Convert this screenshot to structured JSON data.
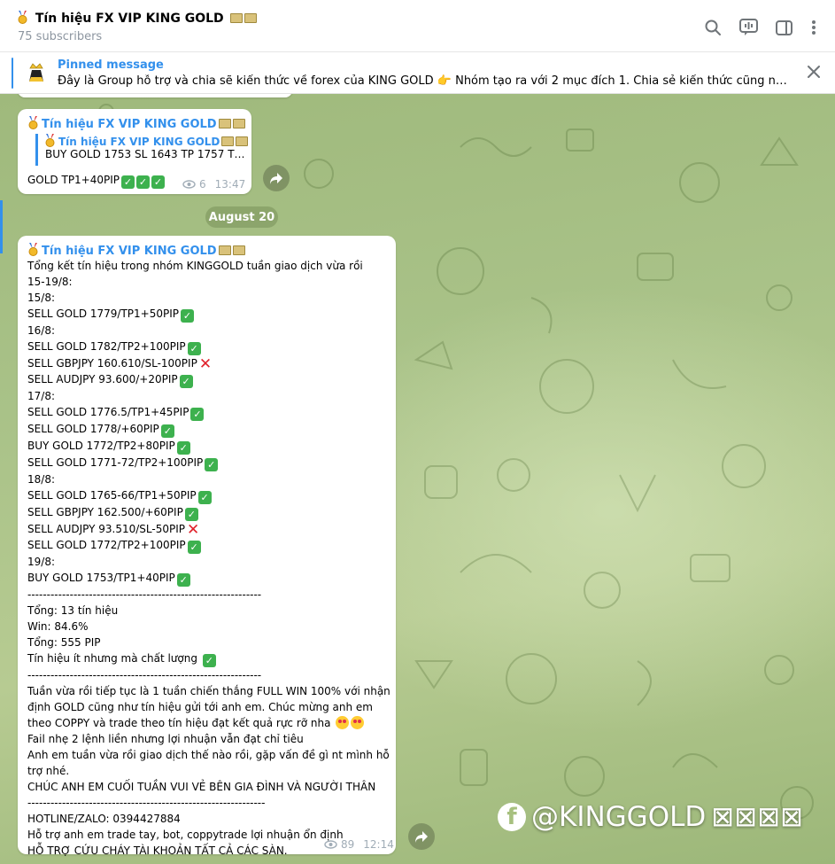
{
  "header": {
    "title": "Tín hiệu FX VIP KING GOLD",
    "subscribers": "75 subscribers",
    "icons": [
      "search-icon",
      "voice-chat-icon",
      "sidebar-icon",
      "more-icon"
    ]
  },
  "pinned": {
    "label": "Pinned message",
    "text": "Đây là Group hỗ trợ và chia sẽ kiến thức về forex của KING GOLD  👉 Nhóm tạo ra với 2 mục đích  1. Chia sẻ kiến thức cũng như hỗ trợ p..."
  },
  "message1": {
    "sender": "Tín hiệu FX VIP KING GOLD",
    "forward_name": "Tín hiệu FX VIP KING GOLD",
    "forward_text": "BUY GOLD 1753 SL   1643 TP   1757 TP...",
    "text": "GOLD TP1+40PIP",
    "views": "6",
    "time": "13:47"
  },
  "date_separator": "August 20",
  "message2": {
    "sender": "Tín hiệu FX VIP KING GOLD",
    "lines": [
      {
        "t": "Tổng kết tín hiệu trong nhóm KINGGOLD tuần giao dịch vừa rồi",
        "m": ""
      },
      {
        "t": "15-19/8:",
        "m": ""
      },
      {
        "t": "15/8:",
        "m": ""
      },
      {
        "t": "SELL GOLD 1779/TP1+50PIP",
        "m": "ok"
      },
      {
        "t": "16/8:",
        "m": ""
      },
      {
        "t": "SELL GOLD 1782/TP2+100PIP",
        "m": "ok"
      },
      {
        "t": "SELL GBPJPY  160.610/SL-100PIP",
        "m": "no"
      },
      {
        "t": "SELL AUDJPY   93.600/+20PIP",
        "m": "ok"
      },
      {
        "t": "17/8:",
        "m": ""
      },
      {
        "t": "SELL GOLD 1776.5/TP1+45PIP",
        "m": "ok"
      },
      {
        "t": "SELL GOLD  1778/+60PIP",
        "m": "ok"
      },
      {
        "t": "BUY GOLD 1772/TP2+80PIP",
        "m": "ok"
      },
      {
        "t": "SELL GOLD 1771-72/TP2+100PIP",
        "m": "ok"
      },
      {
        "t": "18/8:",
        "m": ""
      },
      {
        "t": "SELL GOLD 1765-66/TP1+50PIP",
        "m": "ok"
      },
      {
        "t": "SELL GBPJPY   162.500/+60PIP",
        "m": "ok"
      },
      {
        "t": "SELL AUDJPY  93.510/SL-50PIP",
        "m": "no"
      },
      {
        "t": "SELL GOLD 1772/TP2+100PIP",
        "m": "ok"
      },
      {
        "t": "19/8:",
        "m": ""
      },
      {
        "t": "BUY GOLD 1753/TP1+40PIP",
        "m": "ok"
      },
      {
        "t": "-------------------------------------------------------------",
        "m": ""
      },
      {
        "t": "Tổng: 13 tín hiệu",
        "m": ""
      },
      {
        "t": "Win: 84.6%",
        "m": ""
      },
      {
        "t": "Tổng: 555 PIP",
        "m": ""
      },
      {
        "t": "Tín hiệu ít nhưng mà chất lượng ",
        "m": "ok"
      },
      {
        "t": "-------------------------------------------------------------",
        "m": ""
      },
      {
        "t": "Tuần vừa rồi tiếp tục là 1 tuần chiến thắng FULL WIN 100% với nhận",
        "m": ""
      },
      {
        "t": "định GOLD cũng như tín hiệu gửi tới anh em. Chúc mừng anh em",
        "m": ""
      },
      {
        "t": "theo COPPY và trade theo tín hiệu đạt kết quả rực rỡ nha ",
        "m": "emo2"
      },
      {
        "t": "Fail nhẹ 2 lệnh liền nhưng lợi nhuận vẫn đạt chỉ tiêu",
        "m": ""
      },
      {
        "t": "Anh em tuần vừa rồi giao dịch thế nào rồi, gặp vấn đề gì nt mình hỗ",
        "m": ""
      },
      {
        "t": "trợ nhé.",
        "m": ""
      },
      {
        "t": "CHÚC ANH EM CUỐI TUẦN VUI VẺ BÊN GIA ĐÌNH VÀ NGƯỜI THÂN",
        "m": ""
      },
      {
        "t": "--------------------------------------------------------------",
        "m": ""
      },
      {
        "t": "HOTLINE/ZALO: 0394427884",
        "m": ""
      },
      {
        "t": "Hỗ trợ anh em trade tay, bot, coppytrade lợi nhuận ổn định",
        "m": ""
      },
      {
        "t": "HỖ TRỢ CỨU CHÁY TÀI KHOẢN TẤT CẢ CÁC SÀN.",
        "m": ""
      }
    ],
    "views": "89",
    "time": "12:14"
  },
  "watermark": {
    "logo": "f",
    "text": "@KINGGOLD",
    "boxes": "⊠⊠⊠⊠"
  },
  "colors": {
    "accent": "#3390ec",
    "check": "#3db14e",
    "cross": "#e0202a"
  }
}
